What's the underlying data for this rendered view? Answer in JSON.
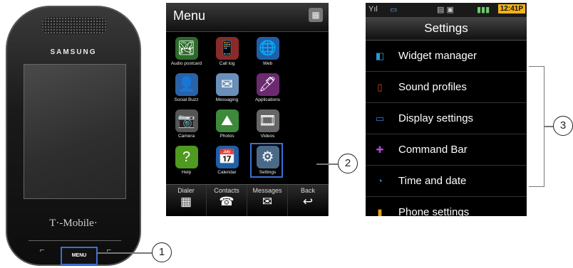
{
  "phone": {
    "brand": "SAMSUNG",
    "carrier": "T·-Mobile·",
    "menu_key": "MENU",
    "left_soft": "⌐",
    "right_soft": "⌐"
  },
  "callouts": [
    "1",
    "2",
    "3"
  ],
  "menu_screen": {
    "title": "Menu",
    "grid_icon": "▦",
    "apps": [
      {
        "label": "Audio postcard",
        "glyph": "🏞",
        "color": "#2d6b2a"
      },
      {
        "label": "Call log",
        "glyph": "📱",
        "color": "#8a2a2a"
      },
      {
        "label": "Web",
        "glyph": "🌐",
        "color": "#1f5fa8"
      },
      {
        "label": "",
        "glyph": "",
        "color": "#000000"
      },
      {
        "label": "Social Buzz",
        "glyph": "👤",
        "color": "#2a62a8"
      },
      {
        "label": "Messaging",
        "glyph": "✉",
        "color": "#6a8fb8"
      },
      {
        "label": "Applications",
        "glyph": "🖊",
        "color": "#6b2a70"
      },
      {
        "label": "",
        "glyph": "",
        "color": "#000000"
      },
      {
        "label": "Camera",
        "glyph": "📷",
        "color": "#555555"
      },
      {
        "label": "Photos",
        "glyph": "⛰",
        "color": "#3d8a3a"
      },
      {
        "label": "Videos",
        "glyph": "🎞",
        "color": "#666666"
      },
      {
        "label": "",
        "glyph": "",
        "color": "#000000"
      },
      {
        "label": "Help",
        "glyph": "?",
        "color": "#4f9a1f"
      },
      {
        "label": "Calendar",
        "glyph": "📅",
        "color": "#1f5fa8"
      },
      {
        "label": "Settings",
        "glyph": "⚙",
        "color": "#4b6a8a"
      },
      {
        "label": "",
        "glyph": "",
        "color": "#000000"
      }
    ],
    "dock": [
      {
        "label": "Dialer",
        "icon": "▦"
      },
      {
        "label": "Contacts",
        "icon": "☎"
      },
      {
        "label": "Messages",
        "icon": "✉"
      },
      {
        "label": "Back",
        "icon": "↩"
      }
    ]
  },
  "settings_screen": {
    "clock": "12:41P",
    "status_left": "Yıl",
    "status_mid": "▭",
    "title": "Settings",
    "items": [
      {
        "label": "Widget manager",
        "icon": "◧",
        "color": "#2a9ad6"
      },
      {
        "label": "Sound profiles",
        "icon": "▯",
        "color": "#e04a1a"
      },
      {
        "label": "Display settings",
        "icon": "▭",
        "color": "#3a7ad6"
      },
      {
        "label": "Command Bar",
        "icon": "✚",
        "color": "#b04ad6"
      },
      {
        "label": "Time and date",
        "icon": "◔",
        "color": "#3a8ad6"
      },
      {
        "label": "Phone settings",
        "icon": "▮",
        "color": "#e0a01a"
      }
    ]
  }
}
